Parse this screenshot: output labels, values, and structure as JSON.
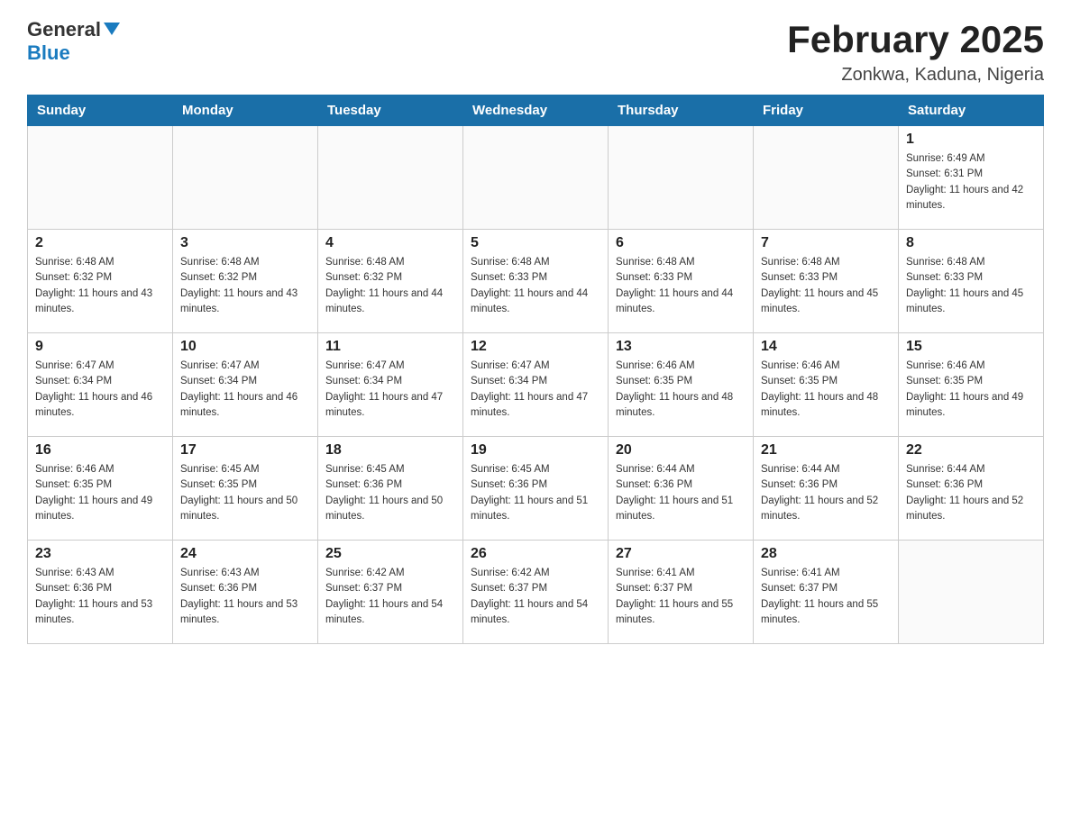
{
  "header": {
    "logo": {
      "text_general": "General",
      "text_blue": "Blue"
    },
    "title": "February 2025",
    "location": "Zonkwa, Kaduna, Nigeria"
  },
  "calendar": {
    "days_of_week": [
      "Sunday",
      "Monday",
      "Tuesday",
      "Wednesday",
      "Thursday",
      "Friday",
      "Saturday"
    ],
    "weeks": [
      [
        {
          "day": "",
          "sunrise": "",
          "sunset": "",
          "daylight": ""
        },
        {
          "day": "",
          "sunrise": "",
          "sunset": "",
          "daylight": ""
        },
        {
          "day": "",
          "sunrise": "",
          "sunset": "",
          "daylight": ""
        },
        {
          "day": "",
          "sunrise": "",
          "sunset": "",
          "daylight": ""
        },
        {
          "day": "",
          "sunrise": "",
          "sunset": "",
          "daylight": ""
        },
        {
          "day": "",
          "sunrise": "",
          "sunset": "",
          "daylight": ""
        },
        {
          "day": "1",
          "sunrise": "Sunrise: 6:49 AM",
          "sunset": "Sunset: 6:31 PM",
          "daylight": "Daylight: 11 hours and 42 minutes."
        }
      ],
      [
        {
          "day": "2",
          "sunrise": "Sunrise: 6:48 AM",
          "sunset": "Sunset: 6:32 PM",
          "daylight": "Daylight: 11 hours and 43 minutes."
        },
        {
          "day": "3",
          "sunrise": "Sunrise: 6:48 AM",
          "sunset": "Sunset: 6:32 PM",
          "daylight": "Daylight: 11 hours and 43 minutes."
        },
        {
          "day": "4",
          "sunrise": "Sunrise: 6:48 AM",
          "sunset": "Sunset: 6:32 PM",
          "daylight": "Daylight: 11 hours and 44 minutes."
        },
        {
          "day": "5",
          "sunrise": "Sunrise: 6:48 AM",
          "sunset": "Sunset: 6:33 PM",
          "daylight": "Daylight: 11 hours and 44 minutes."
        },
        {
          "day": "6",
          "sunrise": "Sunrise: 6:48 AM",
          "sunset": "Sunset: 6:33 PM",
          "daylight": "Daylight: 11 hours and 44 minutes."
        },
        {
          "day": "7",
          "sunrise": "Sunrise: 6:48 AM",
          "sunset": "Sunset: 6:33 PM",
          "daylight": "Daylight: 11 hours and 45 minutes."
        },
        {
          "day": "8",
          "sunrise": "Sunrise: 6:48 AM",
          "sunset": "Sunset: 6:33 PM",
          "daylight": "Daylight: 11 hours and 45 minutes."
        }
      ],
      [
        {
          "day": "9",
          "sunrise": "Sunrise: 6:47 AM",
          "sunset": "Sunset: 6:34 PM",
          "daylight": "Daylight: 11 hours and 46 minutes."
        },
        {
          "day": "10",
          "sunrise": "Sunrise: 6:47 AM",
          "sunset": "Sunset: 6:34 PM",
          "daylight": "Daylight: 11 hours and 46 minutes."
        },
        {
          "day": "11",
          "sunrise": "Sunrise: 6:47 AM",
          "sunset": "Sunset: 6:34 PM",
          "daylight": "Daylight: 11 hours and 47 minutes."
        },
        {
          "day": "12",
          "sunrise": "Sunrise: 6:47 AM",
          "sunset": "Sunset: 6:34 PM",
          "daylight": "Daylight: 11 hours and 47 minutes."
        },
        {
          "day": "13",
          "sunrise": "Sunrise: 6:46 AM",
          "sunset": "Sunset: 6:35 PM",
          "daylight": "Daylight: 11 hours and 48 minutes."
        },
        {
          "day": "14",
          "sunrise": "Sunrise: 6:46 AM",
          "sunset": "Sunset: 6:35 PM",
          "daylight": "Daylight: 11 hours and 48 minutes."
        },
        {
          "day": "15",
          "sunrise": "Sunrise: 6:46 AM",
          "sunset": "Sunset: 6:35 PM",
          "daylight": "Daylight: 11 hours and 49 minutes."
        }
      ],
      [
        {
          "day": "16",
          "sunrise": "Sunrise: 6:46 AM",
          "sunset": "Sunset: 6:35 PM",
          "daylight": "Daylight: 11 hours and 49 minutes."
        },
        {
          "day": "17",
          "sunrise": "Sunrise: 6:45 AM",
          "sunset": "Sunset: 6:35 PM",
          "daylight": "Daylight: 11 hours and 50 minutes."
        },
        {
          "day": "18",
          "sunrise": "Sunrise: 6:45 AM",
          "sunset": "Sunset: 6:36 PM",
          "daylight": "Daylight: 11 hours and 50 minutes."
        },
        {
          "day": "19",
          "sunrise": "Sunrise: 6:45 AM",
          "sunset": "Sunset: 6:36 PM",
          "daylight": "Daylight: 11 hours and 51 minutes."
        },
        {
          "day": "20",
          "sunrise": "Sunrise: 6:44 AM",
          "sunset": "Sunset: 6:36 PM",
          "daylight": "Daylight: 11 hours and 51 minutes."
        },
        {
          "day": "21",
          "sunrise": "Sunrise: 6:44 AM",
          "sunset": "Sunset: 6:36 PM",
          "daylight": "Daylight: 11 hours and 52 minutes."
        },
        {
          "day": "22",
          "sunrise": "Sunrise: 6:44 AM",
          "sunset": "Sunset: 6:36 PM",
          "daylight": "Daylight: 11 hours and 52 minutes."
        }
      ],
      [
        {
          "day": "23",
          "sunrise": "Sunrise: 6:43 AM",
          "sunset": "Sunset: 6:36 PM",
          "daylight": "Daylight: 11 hours and 53 minutes."
        },
        {
          "day": "24",
          "sunrise": "Sunrise: 6:43 AM",
          "sunset": "Sunset: 6:36 PM",
          "daylight": "Daylight: 11 hours and 53 minutes."
        },
        {
          "day": "25",
          "sunrise": "Sunrise: 6:42 AM",
          "sunset": "Sunset: 6:37 PM",
          "daylight": "Daylight: 11 hours and 54 minutes."
        },
        {
          "day": "26",
          "sunrise": "Sunrise: 6:42 AM",
          "sunset": "Sunset: 6:37 PM",
          "daylight": "Daylight: 11 hours and 54 minutes."
        },
        {
          "day": "27",
          "sunrise": "Sunrise: 6:41 AM",
          "sunset": "Sunset: 6:37 PM",
          "daylight": "Daylight: 11 hours and 55 minutes."
        },
        {
          "day": "28",
          "sunrise": "Sunrise: 6:41 AM",
          "sunset": "Sunset: 6:37 PM",
          "daylight": "Daylight: 11 hours and 55 minutes."
        },
        {
          "day": "",
          "sunrise": "",
          "sunset": "",
          "daylight": ""
        }
      ]
    ]
  }
}
